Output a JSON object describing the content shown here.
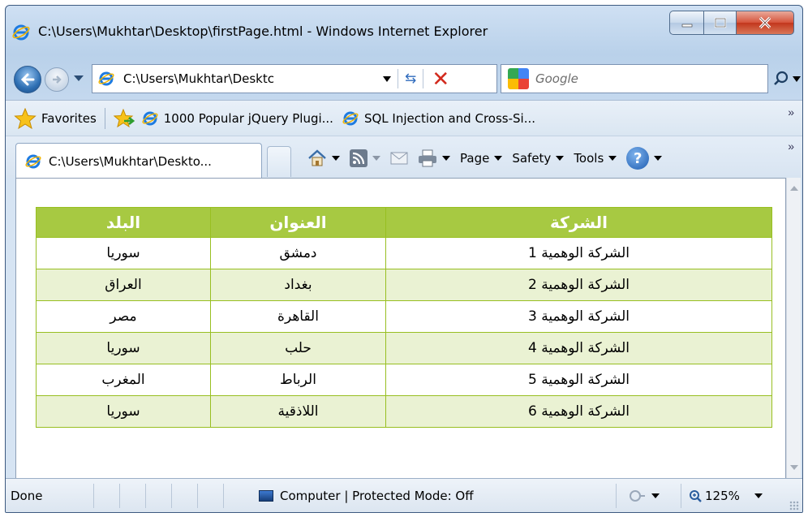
{
  "window": {
    "title": "C:\\Users\\Mukhtar\\Desktop\\firstPage.html - Windows Internet Explorer"
  },
  "address": {
    "url": "C:\\Users\\Mukhtar\\Desktc",
    "search_placeholder": "Google"
  },
  "favorites": {
    "label": "Favorites",
    "items": [
      {
        "label": "1000 Popular jQuery Plugi..."
      },
      {
        "label": "SQL Injection and Cross-Si..."
      }
    ]
  },
  "tab": {
    "label": "C:\\Users\\Mukhtar\\Deskto..."
  },
  "commands": {
    "page": "Page",
    "safety": "Safety",
    "tools": "Tools",
    "help": "?"
  },
  "table": {
    "headers": [
      "الشركة",
      "العنوان",
      "البلد"
    ],
    "rows": [
      [
        "الشركة الوهمية 1",
        "دمشق",
        "سوريا"
      ],
      [
        "الشركة الوهمية 2",
        "بغداد",
        "العراق"
      ],
      [
        "الشركة الوهمية 3",
        "القاهرة",
        "مصر"
      ],
      [
        "الشركة الوهمية 4",
        "حلب",
        "سوريا"
      ],
      [
        "الشركة الوهمية 5",
        "الرباط",
        "المغرب"
      ],
      [
        "الشركة الوهمية 6",
        "اللاذقية",
        "سوريا"
      ]
    ],
    "header_color": "#A7C942",
    "alt_row_color": "#EAF2D3"
  },
  "status": {
    "text": "Done",
    "zone": "Computer | Protected Mode: Off",
    "zoom": "125%"
  }
}
